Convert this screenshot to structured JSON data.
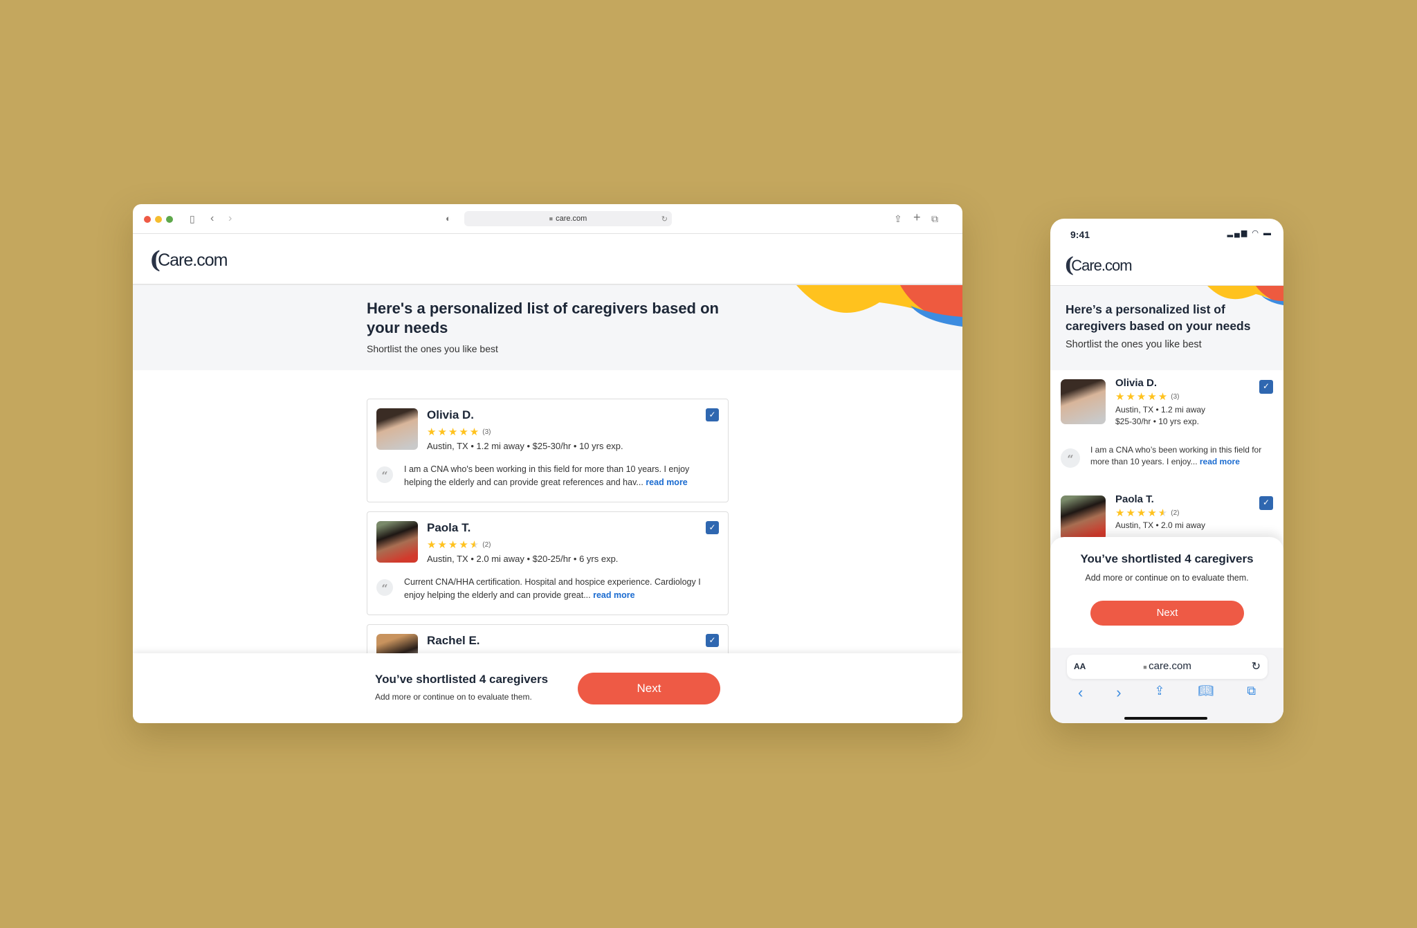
{
  "browser": {
    "url": "care.com",
    "logo": "Care.com",
    "hero": {
      "title": "Here's a personalized list of caregivers based on your needs",
      "subtitle": "Shortlist the ones you like best"
    },
    "caregivers": [
      {
        "name": "Olivia D.",
        "rating": 5,
        "reviews": "(3)",
        "meta": "Austin, TX  •  1.2 mi away • $25-30/hr • 10 yrs exp.",
        "quote": "I am a CNA who's been working in this field for more than 10 years. I enjoy helping the elderly and can provide great references and hav...",
        "read_more": "read more",
        "selected": true
      },
      {
        "name": "Paola T.",
        "rating": 4.5,
        "reviews": "(2)",
        "meta": "Austin, TX  • 2.0 mi away • $20-25/hr • 6 yrs exp.",
        "quote": "Current CNA/HHA certification. Hospital and hospice experience. Cardiology I enjoy helping the elderly and can provide great...",
        "read_more": "read more",
        "selected": true
      },
      {
        "name": "Rachel E.",
        "selected": true
      }
    ],
    "footer": {
      "title": "You’ve shortlisted 4 caregivers",
      "subtitle": "Add more or continue on to evaluate them.",
      "next": "Next"
    }
  },
  "phone": {
    "time": "9:41",
    "logo": "Care.com",
    "hero": {
      "title": "Here’s a personalized list of caregivers based on your needs",
      "subtitle": "Shortlist the ones you like best"
    },
    "caregivers": [
      {
        "name": "Olivia D.",
        "reviews": "(3)",
        "meta1": "Austin, TX  •  1.2 mi away",
        "meta2": "$25-30/hr • 10 yrs exp.",
        "quote": "I am a CNA who’s been working in this field for more than 10 years. I enjoy...",
        "read_more": "read more"
      },
      {
        "name": "Paola T.",
        "reviews": "(2)",
        "meta1": "Austin, TX  • 2.0 mi away"
      }
    ],
    "sheet": {
      "title": "You’ve shortlisted 4 caregivers",
      "subtitle": "Add more or continue on to evaluate them.",
      "next": "Next"
    },
    "safari": {
      "text_size": "AA",
      "url": "care.com"
    }
  },
  "colors": {
    "background": "#C4A75E",
    "accent": "#EE5A45",
    "checkbox": "#2F67B0",
    "star": "#FFC21E",
    "link": "#1a6bd0"
  }
}
